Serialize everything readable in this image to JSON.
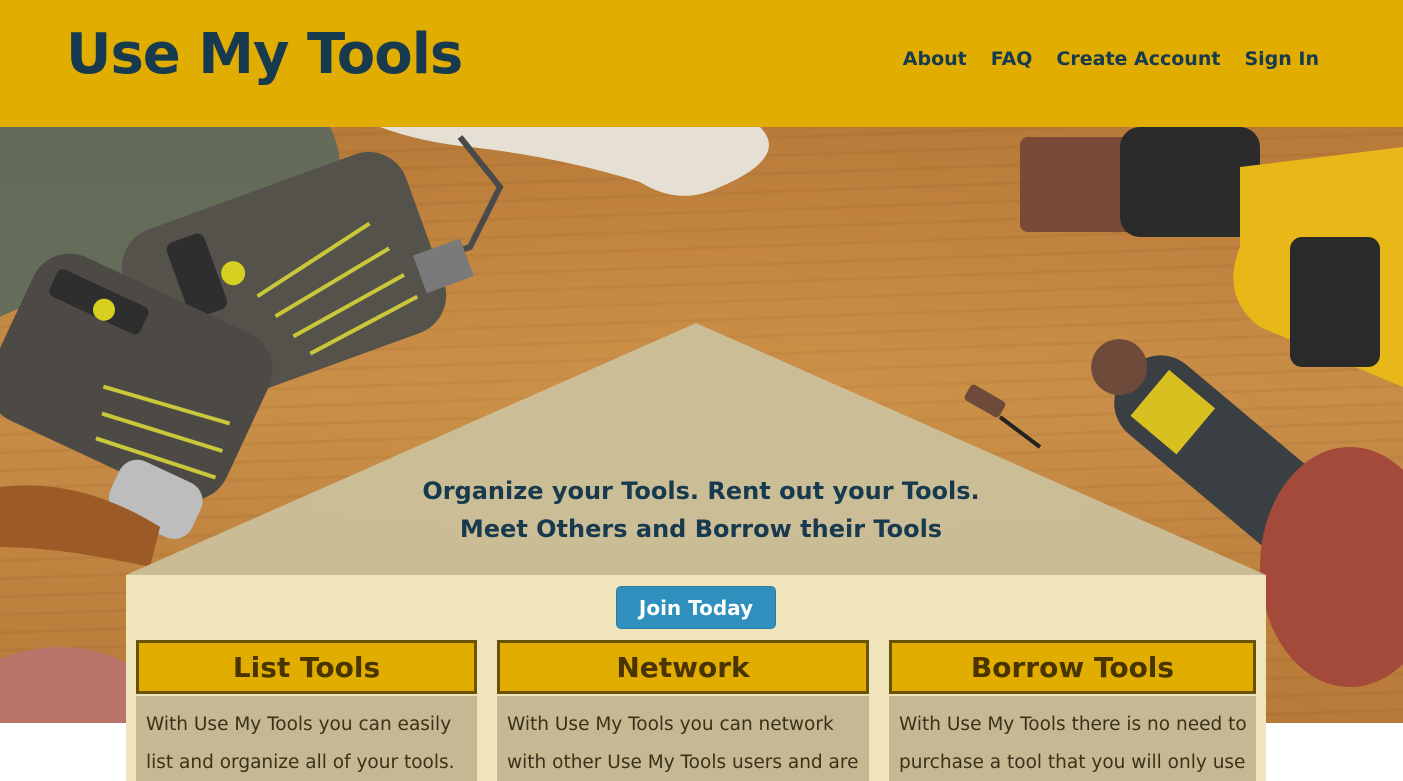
{
  "header": {
    "logo": "Use My Tools",
    "nav": [
      "About",
      "FAQ",
      "Create Account",
      "Sign In"
    ]
  },
  "hero": {
    "tagline_line1": "Organize your Tools. Rent out your Tools.",
    "tagline_line2": "Meet Others and Borrow their Tools",
    "join_button": "Join Today"
  },
  "cards": [
    {
      "title": "List Tools",
      "body": "With Use My Tools you can easily list and organize all of your tools. Once"
    },
    {
      "title": "Network",
      "body": "With Use My Tools you can network with other Use My Tools users and are"
    },
    {
      "title": "Borrow Tools",
      "body": "With Use My Tools there is no need to purchase a tool that you will only use"
    }
  ],
  "colors": {
    "header_bg": "#e0ad00",
    "brand_text": "#173a4e",
    "join_button_bg": "#2f8fbd",
    "panel_bg": "#efe4bc",
    "card_title_bg": "#e0ad00",
    "card_body_bg": "#c5b892"
  },
  "icons": [
    "tools-background-photo"
  ]
}
